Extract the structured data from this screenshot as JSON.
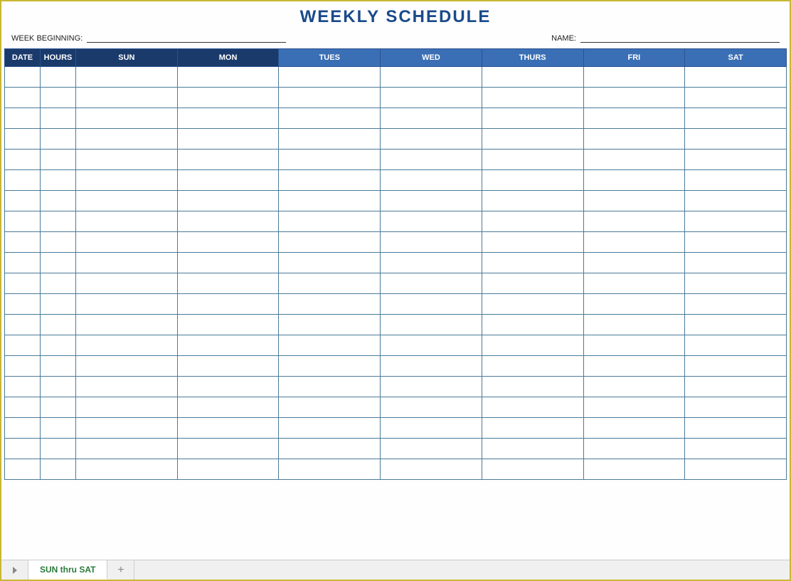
{
  "title": "WEEKLY SCHEDULE",
  "header": {
    "week_label": "WEEK BEGINNING:",
    "week_value": "",
    "name_label": "NAME:",
    "name_value": ""
  },
  "columns": {
    "date": "DATE",
    "hours": "HOURS",
    "sun": "SUN",
    "mon": "MON",
    "tues": "TUES",
    "wed": "WED",
    "thurs": "THURS",
    "fri": "FRI",
    "sat": "SAT"
  },
  "row_count": 20,
  "tabs": {
    "active": "SUN thru SAT"
  }
}
